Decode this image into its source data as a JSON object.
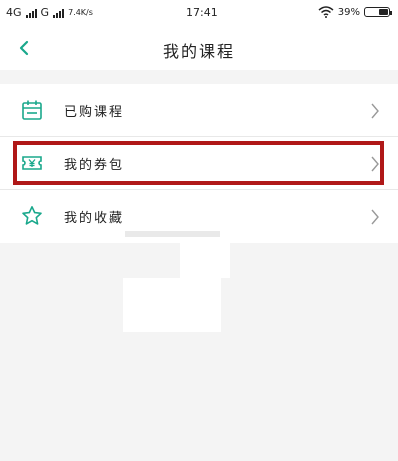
{
  "status_bar": {
    "network_1": "4G",
    "network_2": "G",
    "speed": "7.4K/s",
    "time": "17:41",
    "battery": "39%",
    "battery_level": 0.39
  },
  "header": {
    "back_icon": "chevron-left-icon",
    "title": "我的课程"
  },
  "menu": {
    "items": [
      {
        "label": "已购课程",
        "icon": "calendar-icon"
      },
      {
        "label": "我的券包",
        "icon": "coupon-icon",
        "highlighted": true
      },
      {
        "label": "我的收藏",
        "icon": "star-icon"
      }
    ]
  },
  "colors": {
    "accent": "#1aa88c",
    "highlight_border": "#b01818",
    "background": "#f4f4f4"
  }
}
